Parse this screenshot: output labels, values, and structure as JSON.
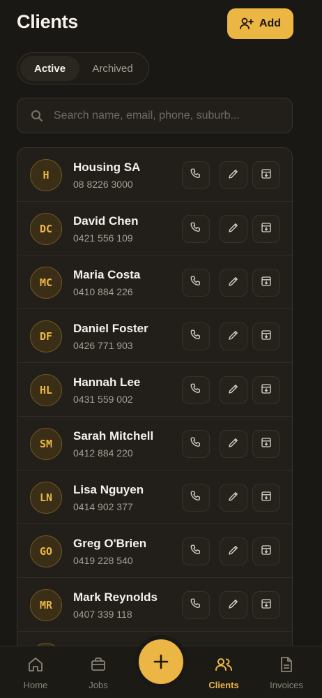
{
  "header": {
    "title": "Clients",
    "add_label": "Add"
  },
  "tabs": [
    {
      "label": "Active",
      "active": true
    },
    {
      "label": "Archived",
      "active": false
    }
  ],
  "search": {
    "placeholder": "Search name, email, phone, suburb...",
    "value": ""
  },
  "clients": [
    {
      "initials": "H",
      "name": "Housing SA",
      "phone": "08 8226 3000"
    },
    {
      "initials": "DC",
      "name": "David Chen",
      "phone": "0421 556 109"
    },
    {
      "initials": "MC",
      "name": "Maria Costa",
      "phone": "0410 884 226"
    },
    {
      "initials": "DF",
      "name": "Daniel Foster",
      "phone": "0426 771 903"
    },
    {
      "initials": "HL",
      "name": "Hannah Lee",
      "phone": "0431 559 002"
    },
    {
      "initials": "SM",
      "name": "Sarah Mitchell",
      "phone": "0412 884 220"
    },
    {
      "initials": "LN",
      "name": "Lisa Nguyen",
      "phone": "0414 902 377"
    },
    {
      "initials": "GO",
      "name": "Greg O'Brien",
      "phone": "0419 228 540"
    },
    {
      "initials": "MR",
      "name": "Mark Reynolds",
      "phone": "0407 339 118"
    }
  ],
  "row_actions": {
    "call": "phone-icon",
    "edit": "pencil-icon",
    "archive": "archive-box-icon"
  },
  "nav": [
    {
      "label": "Home",
      "icon": "home-icon",
      "active": false
    },
    {
      "label": "Jobs",
      "icon": "briefcase-icon",
      "active": false
    },
    {
      "label": "Clients",
      "icon": "users-icon",
      "active": true
    },
    {
      "label": "Invoices",
      "icon": "document-icon",
      "active": false
    }
  ],
  "colors": {
    "accent": "#ecb644",
    "background": "#1a1814",
    "surface": "#221f1a"
  }
}
